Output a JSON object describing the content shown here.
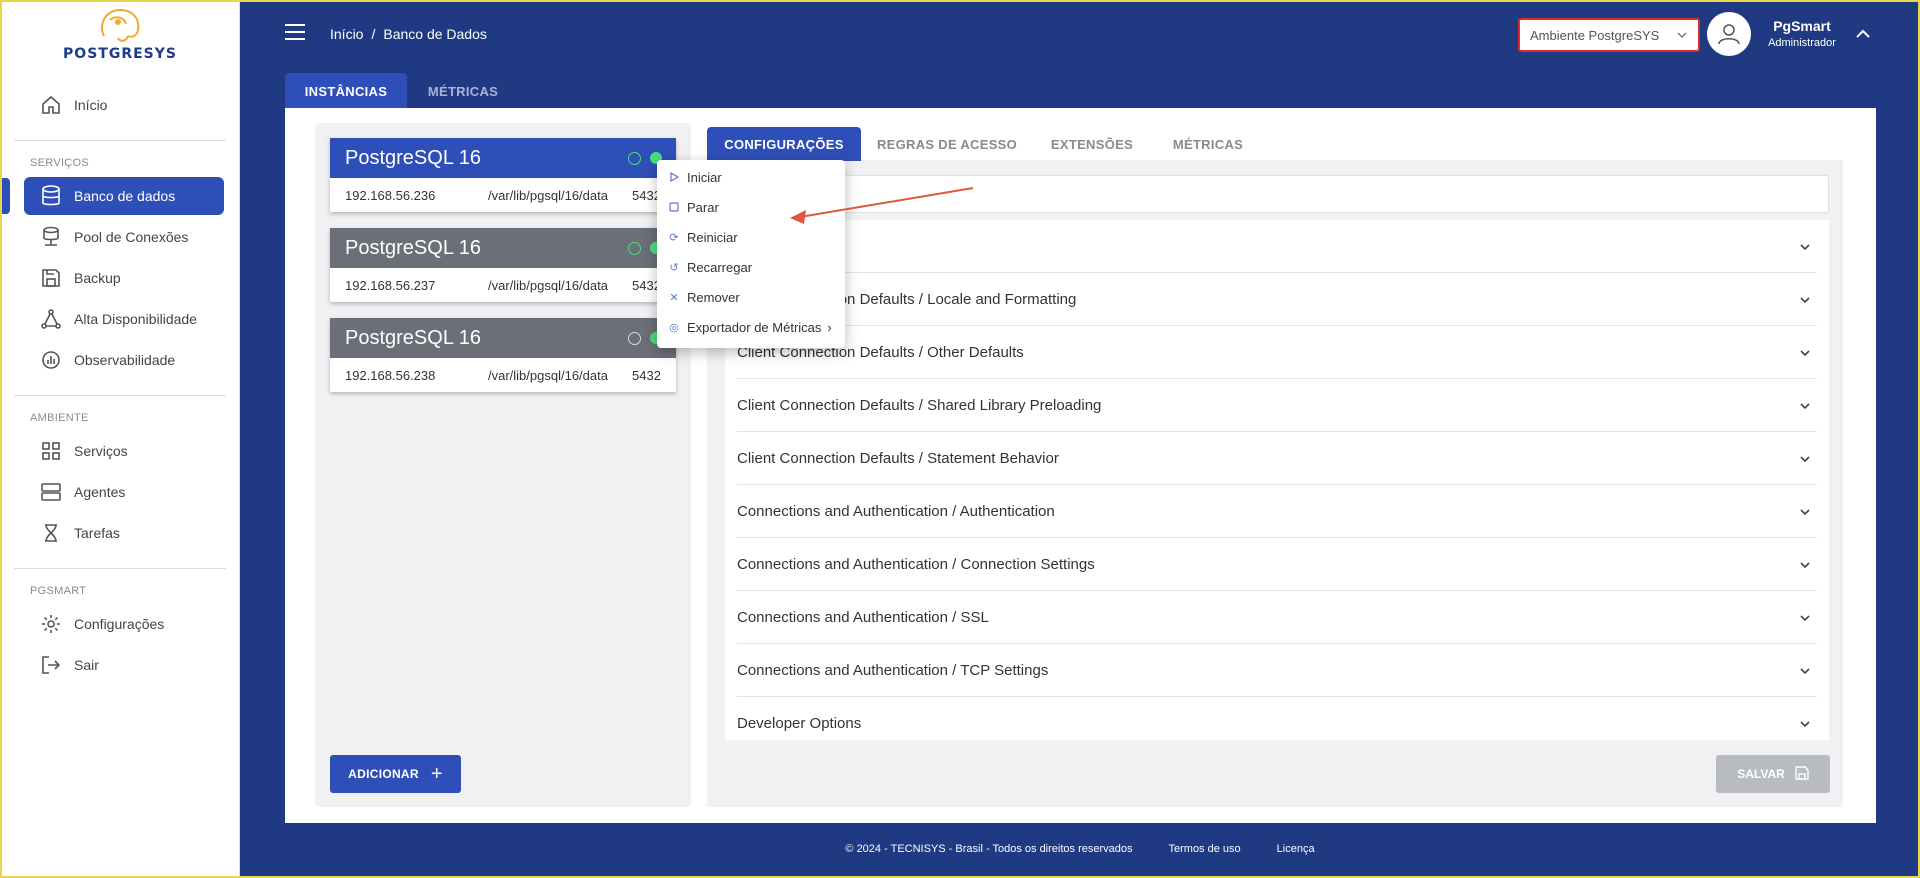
{
  "app": {
    "logo_text": "POSTGRESYS"
  },
  "sidebar": {
    "items": [
      {
        "label": "Início",
        "icon": "home-icon"
      },
      {
        "label": "Banco de dados",
        "icon": "database-icon"
      },
      {
        "label": "Pool de Conexões",
        "icon": "pool-icon"
      },
      {
        "label": "Backup",
        "icon": "save-icon"
      },
      {
        "label": "Alta Disponibilidade",
        "icon": "network-icon"
      },
      {
        "label": "Observabilidade",
        "icon": "chart-icon"
      },
      {
        "label": "Serviços",
        "icon": "grid-icon"
      },
      {
        "label": "Agentes",
        "icon": "server-icon"
      },
      {
        "label": "Tarefas",
        "icon": "hourglass-icon"
      },
      {
        "label": "Configurações",
        "icon": "gear-icon"
      },
      {
        "label": "Sair",
        "icon": "logout-icon"
      }
    ],
    "sections": {
      "servicos": "SERVIÇOS",
      "ambiente": "AMBIENTE",
      "pgsmart": "PGSMART"
    }
  },
  "header": {
    "breadcrumb": [
      "Início",
      "/",
      "Banco de Dados"
    ],
    "environment": "Ambiente PostgreSYS",
    "user": {
      "name": "PgSmart",
      "role": "Administrador"
    }
  },
  "main_tabs": [
    "INSTÂNCIAS",
    "MÉTRICAS"
  ],
  "instances": [
    {
      "name": "PostgreSQL 16",
      "ip": "192.168.56.236",
      "path": "/var/lib/pgsql/16/data",
      "port": "5432"
    },
    {
      "name": "PostgreSQL 16",
      "ip": "192.168.56.237",
      "path": "/var/lib/pgsql/16/data",
      "port": "5432"
    },
    {
      "name": "PostgreSQL 16",
      "ip": "192.168.56.238",
      "path": "/var/lib/pgsql/16/data",
      "port": "5432"
    }
  ],
  "add_button": "ADICIONAR",
  "sub_tabs": [
    "CONFIGURAÇÕES",
    "REGRAS DE ACESSO",
    "EXTENSÕES",
    "MÉTRICAS"
  ],
  "context_menu": [
    "Iniciar",
    "Parar",
    "Reiniciar",
    "Recarregar",
    "Remover",
    "Exportador de Métricas"
  ],
  "config_sections": [
    "",
    "Client Connection Defaults / Locale and Formatting",
    "Client Connection Defaults / Other Defaults",
    "Client Connection Defaults / Shared Library Preloading",
    "Client Connection Defaults / Statement Behavior",
    "Connections and Authentication / Authentication",
    "Connections and Authentication / Connection Settings",
    "Connections and Authentication / SSL",
    "Connections and Authentication / TCP Settings",
    "Developer Options"
  ],
  "save_button": "SALVAR",
  "footer": {
    "copyright": "© 2024 - TECNISYS - Brasil - Todos os direitos reservados",
    "terms": "Termos de uso",
    "license": "Licença"
  },
  "colors": {
    "primary": "#2f4fb8",
    "background": "#1f3a82",
    "status_green": "#4ade80",
    "annotation": "#e0573e"
  }
}
